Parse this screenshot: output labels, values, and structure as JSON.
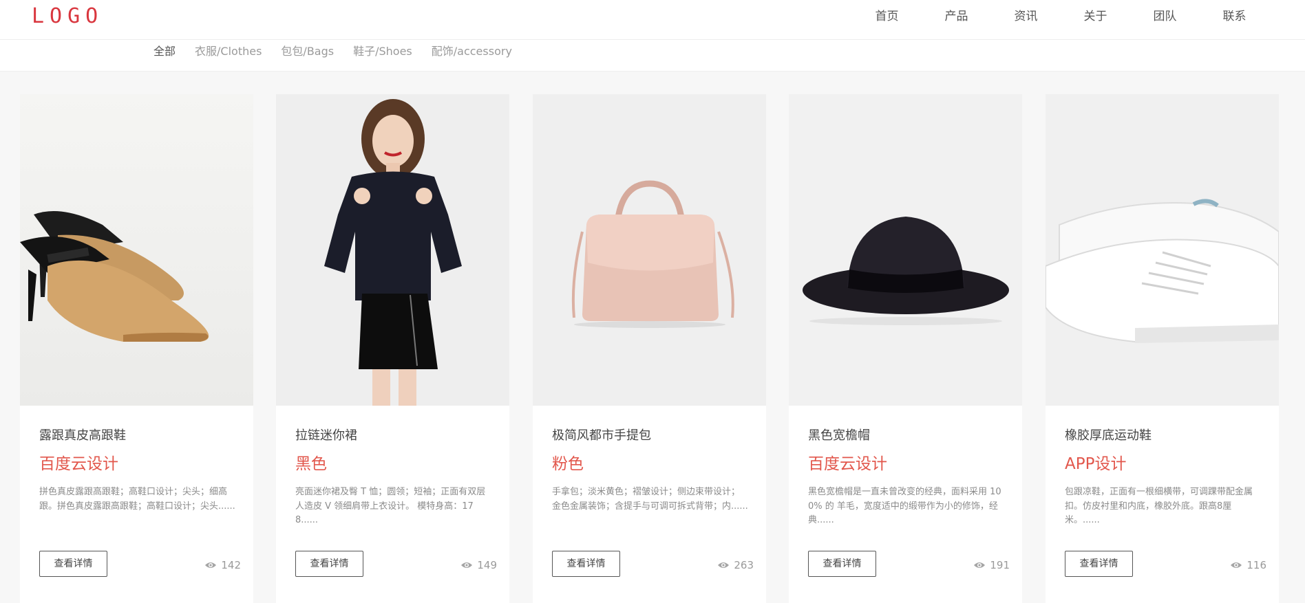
{
  "header": {
    "logo": "LOGO",
    "nav": [
      "首页",
      "产品",
      "资讯",
      "关于",
      "团队",
      "联系"
    ]
  },
  "filters": [
    "全部",
    "衣服/Clothes",
    "包包/Bags",
    "鞋子/Shoes",
    "配饰/accessory"
  ],
  "active_filter": "全部",
  "colors": {
    "brand": "#d9363e",
    "accent": "#e2574c",
    "text": "#444444",
    "muted": "#8a8a8a"
  },
  "products": [
    {
      "image_icon": "heels-image",
      "title": "露跟真皮高跟鞋",
      "subtitle": "百度云设计",
      "description": "拼色真皮露跟高跟鞋；高鞋口设计；尖头；细高跟。拼色真皮露跟高跟鞋；高鞋口设计；尖头......",
      "button": "查看详情",
      "views": "142"
    },
    {
      "image_icon": "model-skirt-image",
      "title": "拉链迷你裙",
      "subtitle": "黑色",
      "description": "亮面迷你裙及臀 T 恤；圆领；短袖；正面有双层人造皮 V 领细肩带上衣设计。 模特身高：178......",
      "button": "查看详情",
      "views": "149"
    },
    {
      "image_icon": "handbag-image",
      "title": "极简风都市手提包",
      "subtitle": "粉色",
      "description": "手拿包；淡米黄色；褶皱设计；侧边束带设计；金色金属装饰；含提手与可调可拆式背带；内......",
      "button": "查看详情",
      "views": "263"
    },
    {
      "image_icon": "hat-image",
      "title": "黑色宽檐帽",
      "subtitle": "百度云设计",
      "description": "黑色宽檐帽是一直未曾改变的经典，面料采用 100% 的 羊毛，宽度适中的缎带作为小的修饰，经典......",
      "button": "查看详情",
      "views": "191"
    },
    {
      "image_icon": "sneakers-image",
      "title": "橡胶厚底运动鞋",
      "subtitle": "APP设计",
      "description": "包跟凉鞋，正面有一根细横带，可调踝带配金属扣。仿皮衬里和内底，橡胶外底。跟高8厘米。......",
      "button": "查看详情",
      "views": "116"
    }
  ]
}
